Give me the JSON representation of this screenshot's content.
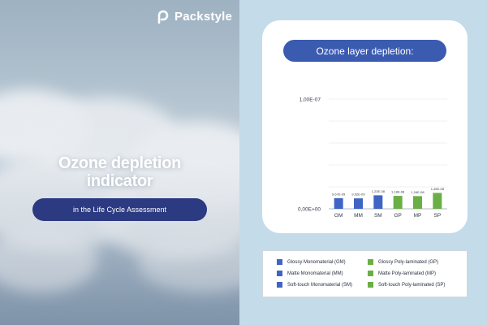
{
  "brand": {
    "name": "Packstyle"
  },
  "hero": {
    "title": "Ozone depletion indicator",
    "subtitle": "in the Life Cycle Assessment"
  },
  "colors": {
    "mono": "#3f64c4",
    "poly": "#6aaf45",
    "pill": "#2c3a82",
    "title_pill": "#3b5bb1",
    "background": "#c4dbe9"
  },
  "chart_data": {
    "type": "bar",
    "title": "Ozone layer depletion:",
    "categories": [
      "GM",
      "MM",
      "SM",
      "GP",
      "MP",
      "SP"
    ],
    "values": [
      9.67e-09,
      9.52e-09,
      1.23e-08,
      1.18e-08,
      1.16e-08,
      1.45e-08
    ],
    "value_labels": [
      "9,67E-09",
      "9,52E-09",
      "1,23E-08",
      "1,18E-08",
      "1,16E-08",
      "1,45E-08"
    ],
    "bar_colors": [
      "#3f64c4",
      "#3f64c4",
      "#3f64c4",
      "#6aaf45",
      "#6aaf45",
      "#6aaf45"
    ],
    "y_ticks": [
      {
        "value": 0,
        "label": "0,00E+00"
      },
      {
        "value": 1e-07,
        "label": "1,00E-07"
      }
    ],
    "ylim": [
      0,
      1e-07
    ],
    "gridlines": 5,
    "grid": true,
    "xlabel": "",
    "ylabel": ""
  },
  "legend": {
    "items": [
      {
        "label": "Glossy Monomaterial (GM)",
        "color": "#3f64c4"
      },
      {
        "label": "Glossy Poly-laminated (GP)",
        "color": "#6aaf45"
      },
      {
        "label": "Matte Monomaterial (MM)",
        "color": "#3f64c4"
      },
      {
        "label": "Matte Poly-laminated (MP)",
        "color": "#6aaf45"
      },
      {
        "label": "Soft-touch Monomaterial (SM)",
        "color": "#3f64c4"
      },
      {
        "label": "Soft-touch Poly-laminated (SP)",
        "color": "#6aaf45"
      }
    ]
  }
}
